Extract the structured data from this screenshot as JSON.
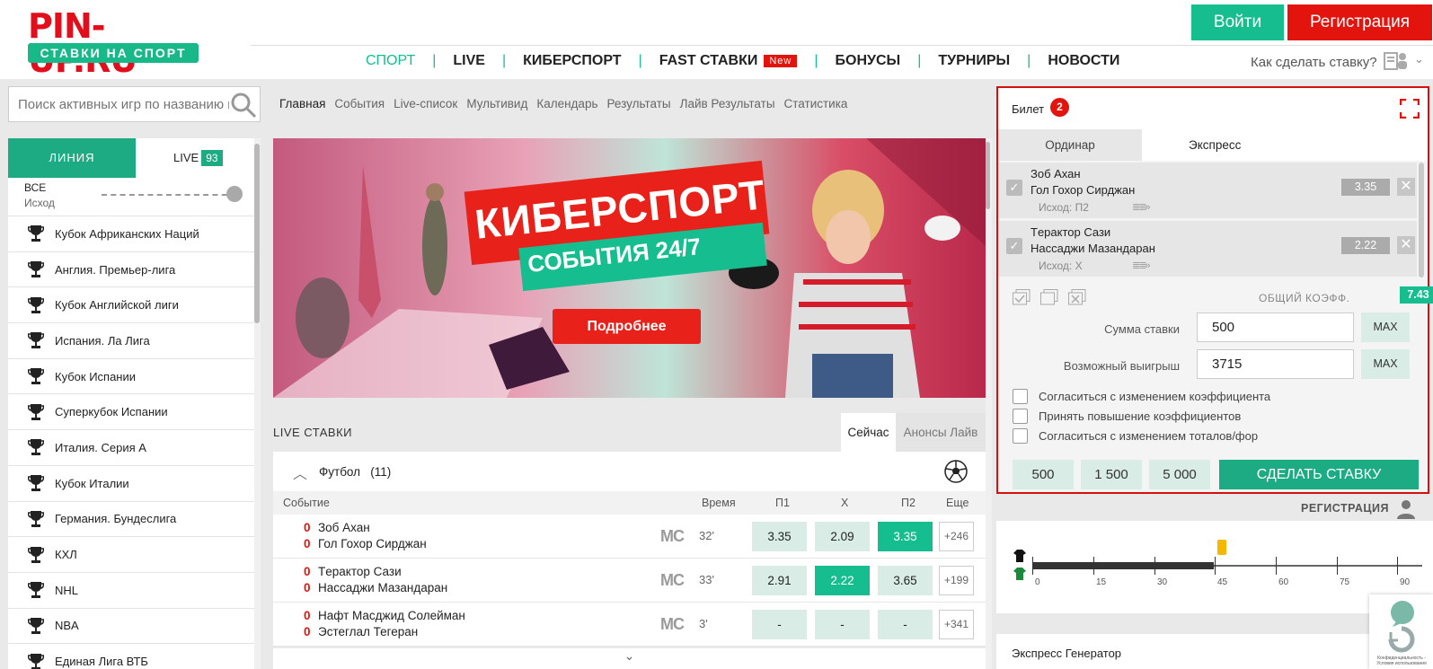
{
  "header": {
    "logo": "PIN-UP.RU",
    "logo_subtitle": "СТАВКИ НА СПОРТ",
    "login_label": "Войти",
    "register_label": "Регистрация",
    "nav": [
      "СПОРТ",
      "LIVE",
      "КИБЕРСПОРТ",
      "FAST СТАВКИ",
      "БОНУСЫ",
      "ТУРНИРЫ",
      "НОВОСТИ"
    ],
    "nav_badge": "New",
    "howto": "Как сделать ставку?"
  },
  "colors": {
    "accent": "#16bd8e",
    "brand_red": "#e3140e"
  },
  "left": {
    "search_placeholder": "Поиск активных игр по названию команды",
    "tab_line": "ЛИНИЯ",
    "tab_live": "LIVE",
    "live_count": "93",
    "filter_all": "ВСЕ",
    "filter_outcome": "Исход",
    "leagues": [
      "Кубок Африканских Наций",
      "Англия. Премьер-лига",
      "Кубок Английской лиги",
      "Испания. Ла Лига",
      "Кубок Испании",
      "Суперкубок Испании",
      "Италия. Серия А",
      "Кубок Италии",
      "Германия. Бундеслига",
      "КХЛ",
      "NHL",
      "NBA",
      "Единая Лига ВТБ"
    ]
  },
  "breadcrumb": [
    "Главная",
    "События",
    "Live-список",
    "Мультивид",
    "Календарь",
    "Результаты",
    "Лайв Результаты",
    "Статистика"
  ],
  "banner": {
    "title": "КИБЕРСПОРТ",
    "subtitle": "СОБЫТИЯ 24/7",
    "button": "Подробнее"
  },
  "live": {
    "title": "LIVE СТАВКИ",
    "tab_now": "Сейчас",
    "tab_soon": "Анонсы Лайв",
    "sport": "Футбол",
    "sport_count": "(11)",
    "columns": {
      "event": "Событие",
      "time": "Время",
      "p1": "П1",
      "x": "Х",
      "p2": "П2",
      "more": "Еще"
    },
    "matches": [
      {
        "home": "Зоб Ахан",
        "away": "Гол Гохор Сирджан",
        "score_home": "0",
        "score_away": "0",
        "mc": "MC",
        "time": "32'",
        "p1": "3.35",
        "x": "2.09",
        "p2": "3.35",
        "more": "+246",
        "selected": "p2"
      },
      {
        "home": "Тeрактор Сази",
        "away": "Нассаджи Мазандаран",
        "score_home": "0",
        "score_away": "0",
        "mc": "MC",
        "time": "33'",
        "p1": "2.91",
        "x": "2.22",
        "p2": "3.65",
        "more": "+199",
        "selected": "x"
      },
      {
        "home": "Нафт Масджид Солейман",
        "away": "Эстеглал Тегеран",
        "score_home": "0",
        "score_away": "0",
        "mc": "MC",
        "time": "3'",
        "p1": "-",
        "x": "-",
        "p2": "-",
        "more": "+341",
        "selected": ""
      }
    ]
  },
  "slip": {
    "title": "Билет",
    "count": "2",
    "tab_single": "Ординар",
    "tab_express": "Экспресс",
    "bets": [
      {
        "team1": "Зоб Ахан",
        "team2": "Гол Гохор Сирджан",
        "outcome": "Исход: П2",
        "odd": "3.35"
      },
      {
        "team1": "Тeрактор Сази",
        "team2": "Нассаджи Мазандаран",
        "outcome": "Исход: Х",
        "odd": "2.22"
      }
    ],
    "total_label": "ОБЩИЙ КОЭФФ.",
    "total_value": "7.43",
    "stake_label": "Сумма ставки",
    "stake_value": "500",
    "win_label": "Возможный выигрыш",
    "win_value": "3715",
    "max_label": "MAX",
    "options": [
      "Согласиться с изменением коэффициента",
      "Принять повышение коэффициентов",
      "Согласиться с изменением тоталов/фор"
    ],
    "quick": [
      "500",
      "1 500",
      "5 000"
    ],
    "make_bet": "СДЕЛАТЬ СТАВКУ"
  },
  "registration_label": "РЕГИСТРАЦИЯ",
  "timeline_ticks": [
    "0",
    "15",
    "30",
    "45",
    "60",
    "75",
    "90"
  ],
  "express_generator": "Экспресс Генератор",
  "recaptcha_text": "Конфиденциальность - Условия использования"
}
